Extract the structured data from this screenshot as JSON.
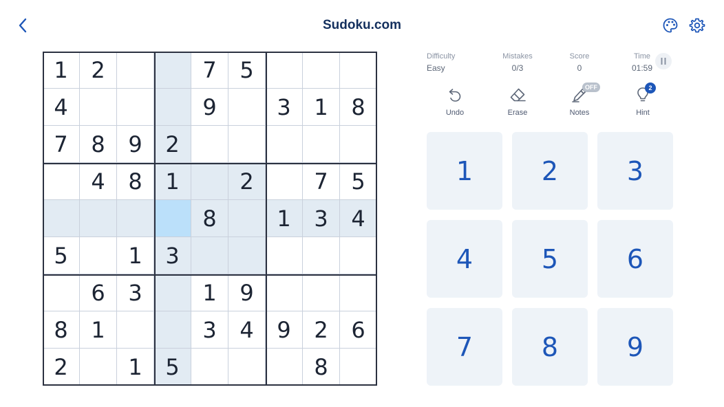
{
  "header": {
    "title": "Sudoku.com",
    "back_icon": "chevron-left-icon",
    "palette_icon": "palette-icon",
    "settings_icon": "gear-icon"
  },
  "colors": {
    "accent": "#1d56b8",
    "selected_cell": "#bbe0fa",
    "highlighted_cell": "#e2ebf3",
    "keypad_bg": "#eef3f8"
  },
  "stats": {
    "difficulty": {
      "label": "Difficulty",
      "value": "Easy"
    },
    "mistakes": {
      "label": "Mistakes",
      "value": "0/3"
    },
    "score": {
      "label": "Score",
      "value": "0"
    },
    "time": {
      "label": "Time",
      "value": "01:59"
    }
  },
  "tools": {
    "undo": {
      "label": "Undo",
      "icon": "undo-icon"
    },
    "erase": {
      "label": "Erase",
      "icon": "eraser-icon"
    },
    "notes": {
      "label": "Notes",
      "icon": "pencil-icon",
      "badge": "OFF"
    },
    "hint": {
      "label": "Hint",
      "icon": "lightbulb-icon",
      "badge": "2"
    }
  },
  "board": {
    "selected": [
      4,
      3
    ],
    "rows": [
      [
        "1",
        "2",
        "",
        "",
        "7",
        "5",
        "",
        "",
        ""
      ],
      [
        "4",
        "",
        "",
        "",
        "9",
        "",
        "3",
        "1",
        "8"
      ],
      [
        "7",
        "8",
        "9",
        "2",
        "",
        "",
        "",
        "",
        ""
      ],
      [
        "",
        "4",
        "8",
        "1",
        "",
        "2",
        "",
        "7",
        "5"
      ],
      [
        "",
        "",
        "",
        "",
        "8",
        "",
        "1",
        "3",
        "4"
      ],
      [
        "5",
        "",
        "1",
        "3",
        "",
        "",
        "",
        "",
        ""
      ],
      [
        "",
        "6",
        "3",
        "",
        "1",
        "9",
        "",
        "",
        ""
      ],
      [
        "8",
        "1",
        "",
        "",
        "3",
        "4",
        "9",
        "2",
        "6"
      ],
      [
        "2",
        "",
        "1",
        "5",
        "",
        "",
        "",
        "8",
        ""
      ]
    ]
  },
  "keypad": [
    "1",
    "2",
    "3",
    "4",
    "5",
    "6",
    "7",
    "8",
    "9"
  ]
}
